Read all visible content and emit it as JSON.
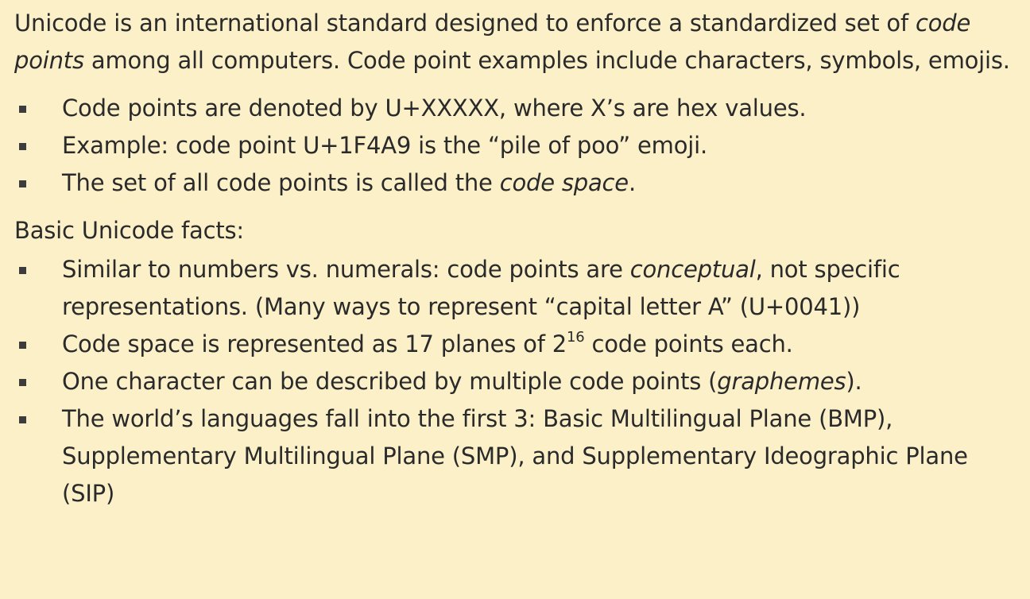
{
  "intro": {
    "part1": "Unicode is an international standard designed to enforce a standardized set of ",
    "emphasis": "code points",
    "part2": " among all computers. Code point examples include characters, symbols, emojis."
  },
  "code_point_bullets": [
    {
      "text": "Code points are denoted by U+XXXXX, where X’s are hex values."
    },
    {
      "text": "Example: code point U+1F4A9 is the “pile of poo” emoji."
    },
    {
      "before": "The set of all code points is called the ",
      "emphasis": "code space",
      "after": "."
    }
  ],
  "facts_heading": "Basic Unicode facts:",
  "facts_bullets": [
    {
      "before": "Similar to numbers vs. numerals: code points are ",
      "emphasis": "conceptual",
      "after": ", not specific representations. (Many ways to represent “capital letter A” (U+0041))"
    },
    {
      "before": "Code space is represented as 17 planes of ",
      "base": "2",
      "exponent": "16",
      "after": " code points each."
    },
    {
      "before": "One character can be described by multiple code points (",
      "emphasis": "graphemes",
      "after": ")."
    },
    {
      "text": "The world’s languages fall into the first 3: Basic Multilingual Plane (BMP), Supplementary Multilingual Plane (SMP), and Supplementary Ideographic Plane (SIP)"
    }
  ],
  "colors": {
    "background": "#fbf0c8",
    "text": "#2a2a2a",
    "bullet": "#3c3c3c"
  }
}
